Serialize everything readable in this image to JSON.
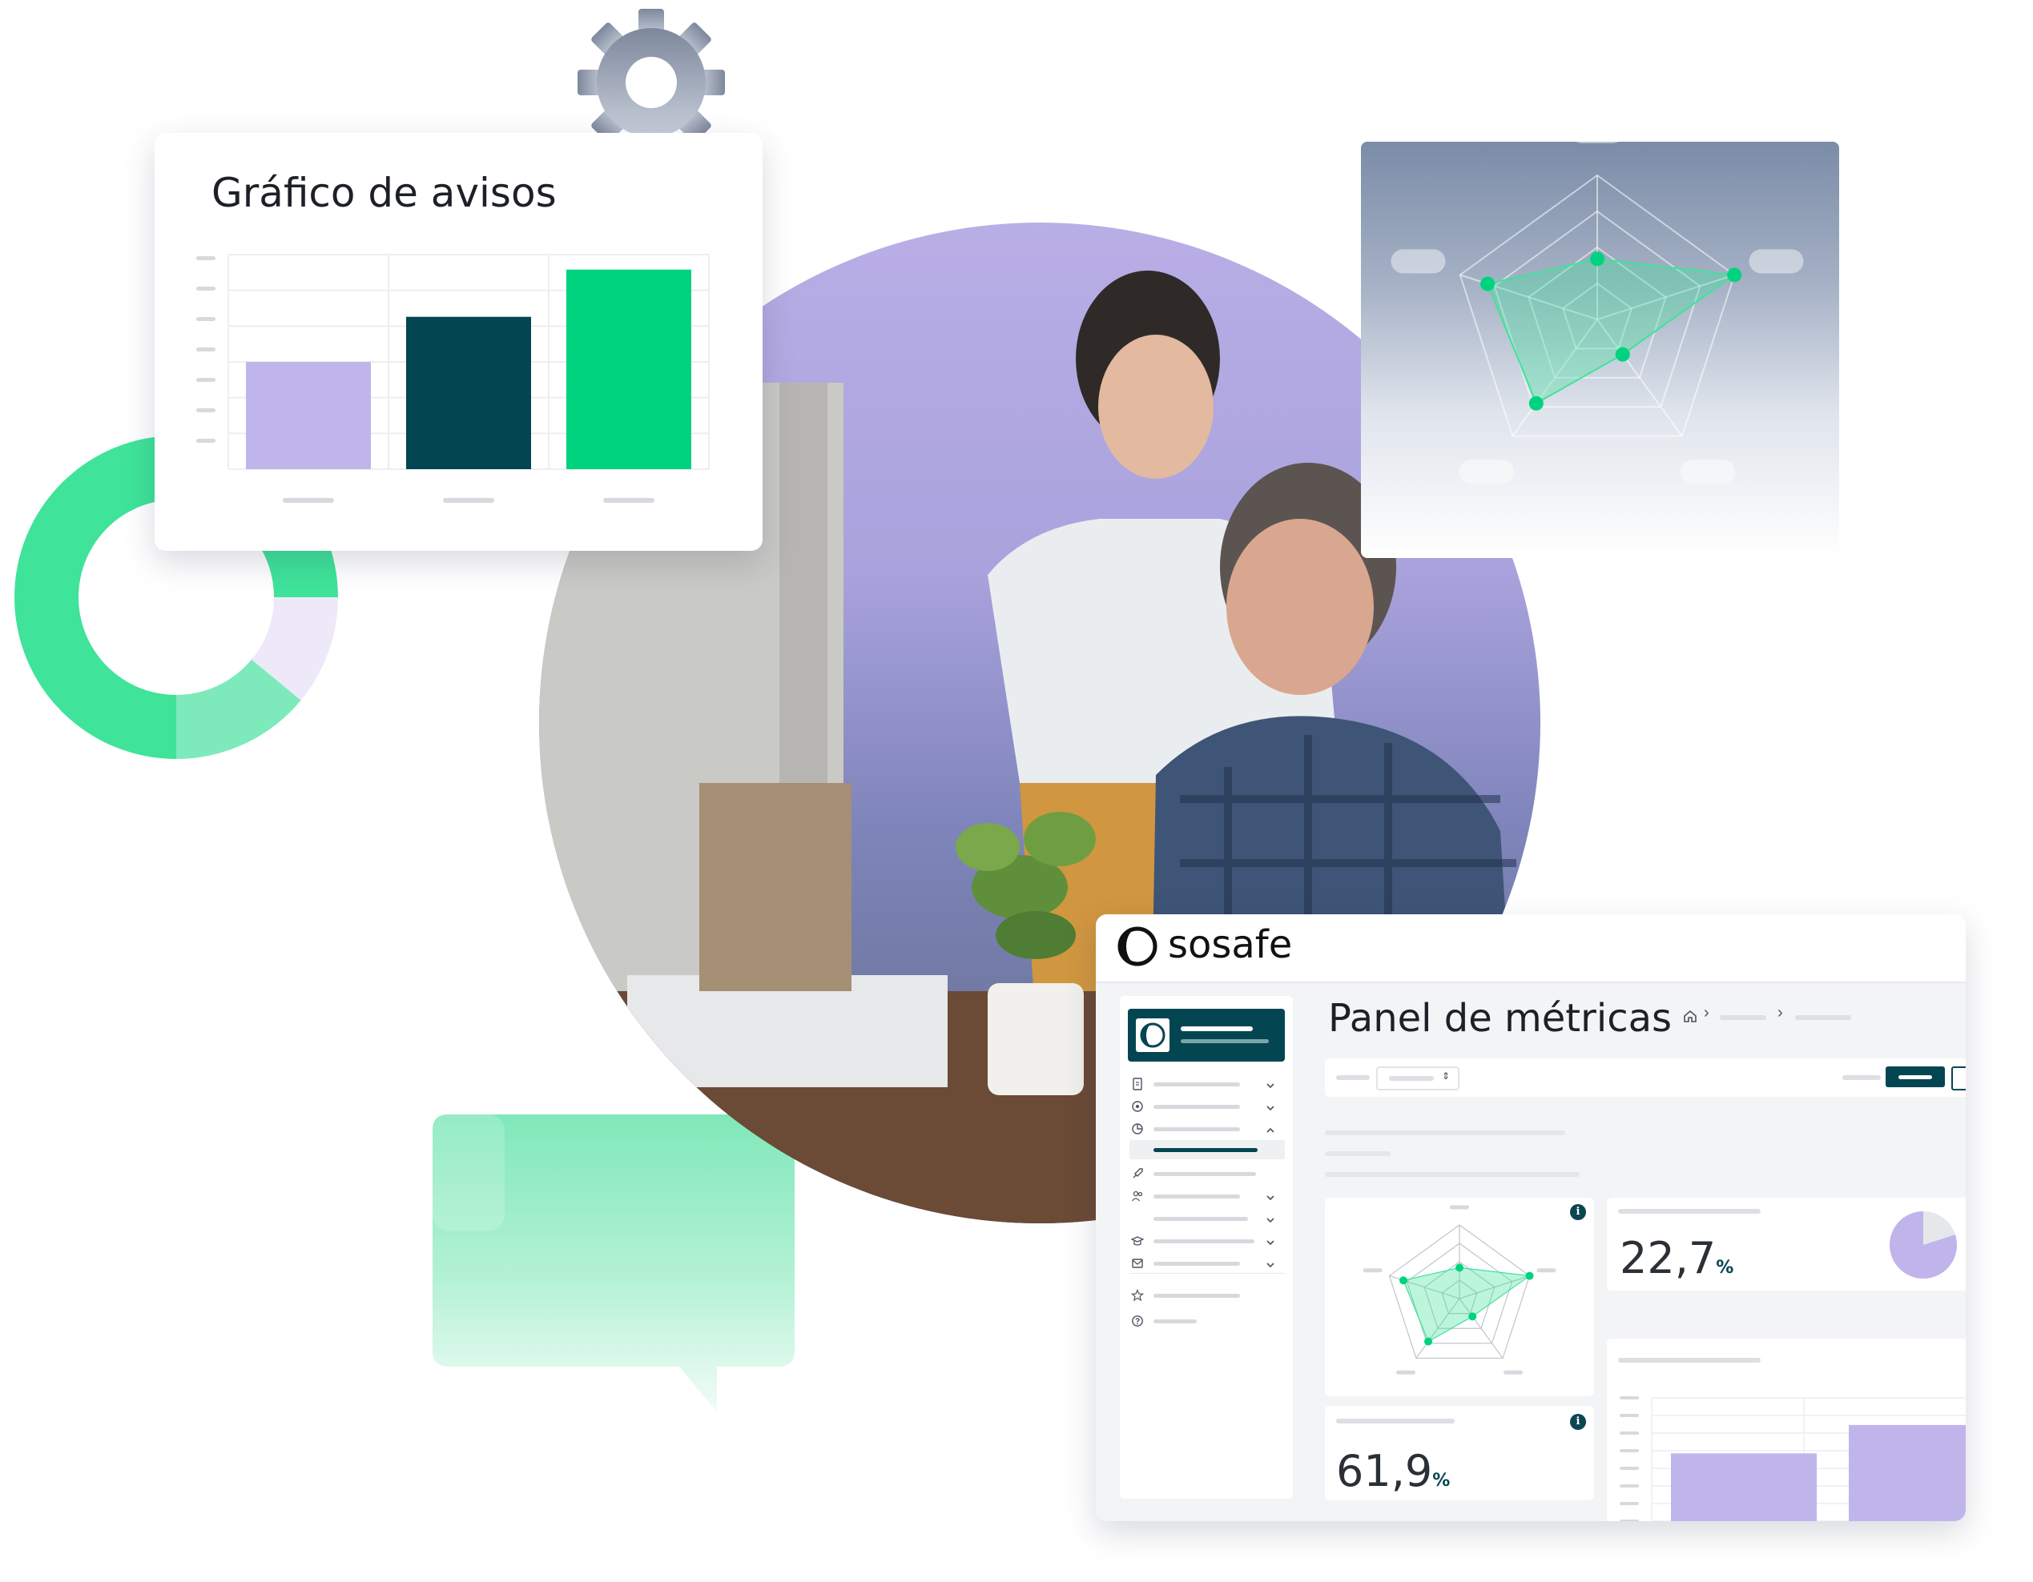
{
  "left_card": {
    "title": "Gráfico de avisos"
  },
  "bar_chart": {
    "type": "bar",
    "values": [
      50,
      71,
      93
    ],
    "ylim": [
      0,
      100
    ],
    "colors": [
      "#c0b5eb",
      "#034652",
      "#00d37f"
    ]
  },
  "donut_chart": {
    "type": "pie",
    "slices": [
      75,
      11,
      14
    ],
    "colors": [
      "#3fe39a",
      "#ede9f9",
      "#7eeabb"
    ]
  },
  "radar_top": {
    "type": "radar",
    "values": [
      0.42,
      1.0,
      0.3,
      0.72,
      0.8
    ]
  },
  "dashboard": {
    "brand": "sosafe",
    "page_title": "Panel de métricas",
    "breadcrumb_separators": [
      "›",
      "›"
    ],
    "select_caret": "⇕",
    "stat_1": {
      "value": "22,7",
      "unit": "%"
    },
    "stat_2": {
      "value": "61,9",
      "unit": "%"
    },
    "info_glyph": "i",
    "radar_small": {
      "values": [
        0.42,
        1.0,
        0.3,
        0.72,
        0.8
      ]
    },
    "bar_small": {
      "values": [
        55,
        78
      ]
    },
    "pie_small": {
      "value": 80
    },
    "nav_icons": [
      "document-icon",
      "target-icon",
      "chart-icon",
      "rocket-icon",
      "users-icon",
      "graduation-icon",
      "mail-icon",
      "star-icon",
      "help-icon"
    ]
  },
  "colors": {
    "accent_green": "#00d37f",
    "dark_teal": "#034652",
    "lavender": "#c0b5eb",
    "gear_gray": "#8892a6"
  }
}
